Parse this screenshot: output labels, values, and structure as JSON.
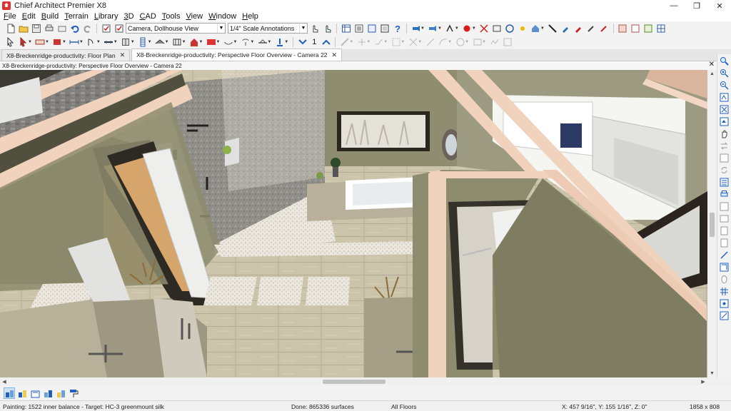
{
  "window": {
    "title": "Chief Architect Premier X8",
    "minimize": "—",
    "maximize": "❐",
    "close": "✕"
  },
  "menu": {
    "items": [
      {
        "key": "F",
        "rest": "ile"
      },
      {
        "key": "E",
        "rest": "dit"
      },
      {
        "key": "B",
        "rest": "uild"
      },
      {
        "key": "T",
        "rest": "errain"
      },
      {
        "key": "L",
        "rest": "ibrary"
      },
      {
        "key": "3",
        "rest": "D"
      },
      {
        "key": "C",
        "rest": "AD"
      },
      {
        "key": "T",
        "rest": "ools"
      },
      {
        "key": "V",
        "rest": "iew"
      },
      {
        "key": "W",
        "rest": "indow"
      },
      {
        "key": "H",
        "rest": "elp"
      }
    ]
  },
  "toolbar": {
    "camera_combo": "Camera, Dollhouse View",
    "scale_combo": "1/4\" Scale Annotations",
    "number_value": "1"
  },
  "tabs": [
    {
      "label": "X8-Breckenridge-productivity: Floor Plan",
      "close": "✕",
      "active": false
    },
    {
      "label": "X8-Breckenridge-productivity: Perspective Floor Overview - Camera 22",
      "close": "✕",
      "active": true
    }
  ],
  "view": {
    "header": "X8-Breckenridge-productivity: Perspective Floor Overview - Camera 22",
    "close": "✕"
  },
  "status": {
    "painting": "Painting: 1522 inner balance - Target:  HC-3 greenmount silk",
    "done": "Done:  865336 surfaces",
    "floors": "All Floors",
    "coords": "X: 457 9/16\", Y: 155 1/16\", Z: 0\"",
    "size": "1858 x 808"
  },
  "colors": {
    "wall_sage": "#8d8c6e",
    "wall_dark": "#57563f",
    "wall_cap": "#f0d2bd",
    "tile_floor": "#c9c2a8",
    "stone_wall": "#8c8a86",
    "pebble": "#e9e5dc",
    "wood_floor": "#d9a86e"
  }
}
